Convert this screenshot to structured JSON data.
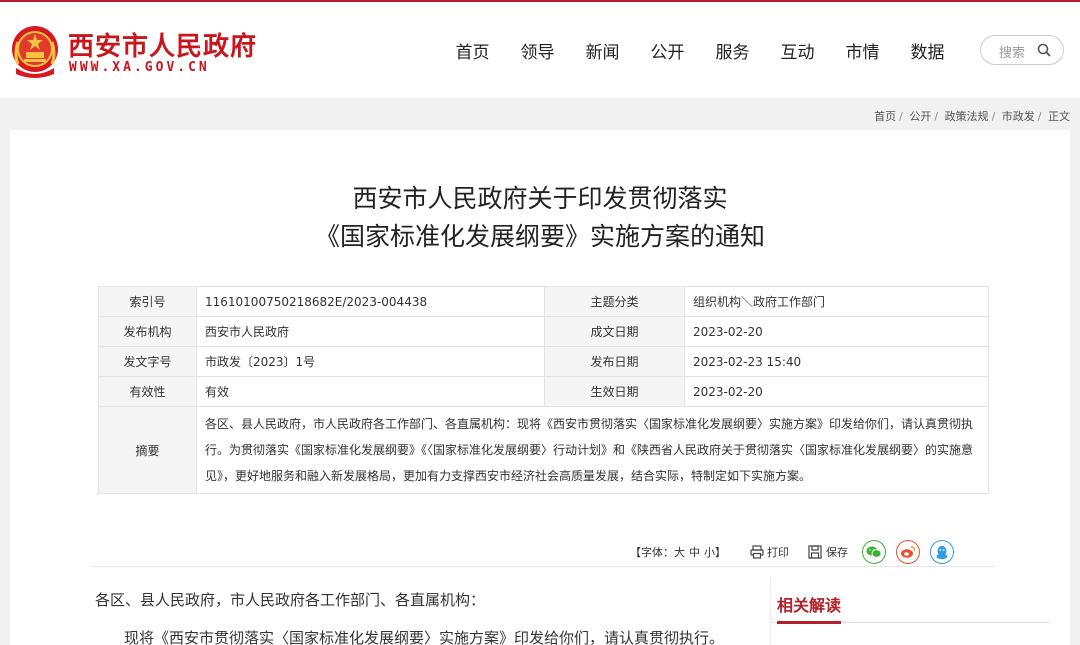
{
  "header": {
    "site_name": "西安市人民政府",
    "site_domain": "WWW.XA.GOV.CN",
    "nav": [
      "首页",
      "领导",
      "新闻",
      "公开",
      "服务",
      "互动",
      "市情",
      "数据"
    ],
    "search_placeholder": "搜索"
  },
  "breadcrumb": [
    "首页",
    "公开",
    "政策法规",
    "市政发",
    "正文"
  ],
  "article": {
    "title_line1": "西安市人民政府关于印发贯彻落实",
    "title_line2": "《国家标准化发展纲要》实施方案的通知"
  },
  "meta": {
    "index_label": "索引号",
    "index_value": "11610100750218682E/2023-004438",
    "topic_label": "主题分类",
    "topic_value": "组织机构＼政府工作部门",
    "issuer_label": "发布机构",
    "issuer_value": "西安市人民政府",
    "written_label": "成文日期",
    "written_value": "2023-02-20",
    "docno_label": "发文字号",
    "docno_value": "市政发〔2023〕1号",
    "published_label": "发布日期",
    "published_value": "2023-02-23 15:40",
    "validity_label": "有效性",
    "validity_value": "有效",
    "effective_label": "生效日期",
    "effective_value": "2023-02-20",
    "abstract_label": "摘要",
    "abstract_value": "各区、县人民政府，市人民政府各工作部门、各直属机构：现将《西安市贯彻落实〈国家标准化发展纲要〉实施方案》印发给你们，请认真贯彻执行。为贯彻落实《国家标准化发展纲要》《〈国家标准化发展纲要〉行动计划》和《陕西省人民政府关于贯彻落实〈国家标准化发展纲要〉的实施意见》，更好地服务和融入新发展格局，更加有力支撑西安市经济社会高质量发展，结合实际，特制定如下实施方案。"
  },
  "toolbar": {
    "font_prefix": "【字体：",
    "font_large": "大",
    "font_medium": "中",
    "font_small": "小",
    "font_suffix": "】",
    "print_label": "打印",
    "save_label": "保存"
  },
  "body": {
    "salutation": "各区、县人民政府，市人民政府各工作部门、各直属机构：",
    "paragraph1": "现将《西安市贯彻落实〈国家标准化发展纲要〉实施方案》印发给你们，请认真贯彻执行。"
  },
  "sidebar": {
    "related_title": "相关解读"
  },
  "colors": {
    "brand_red": "#c8161d",
    "wechat_green": "#3cb034",
    "weibo_orange": "#e8512c",
    "qq_blue": "#2d9fe0"
  }
}
